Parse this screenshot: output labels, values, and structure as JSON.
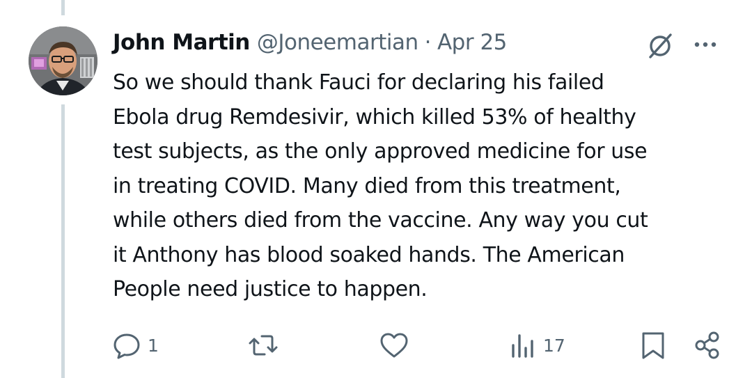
{
  "tweet": {
    "display_name": "John Martin",
    "handle": "@Joneemartian",
    "separator": "·",
    "date": "Apr 25",
    "text_lines": [
      "So we should thank Fauci for declaring his failed",
      "Ebola drug Remdesivir, which killed 53% of healthy",
      "test subjects, as the only approved medicine for use",
      "in treating COVID. Many died from this treatment,",
      "while others died from the vaccine. Any way you cut",
      "it Anthony has blood soaked hands. The American",
      "People need justice to happen."
    ]
  },
  "header_icons": {
    "grok": "grok-icon",
    "more": "more-icon"
  },
  "actions": {
    "reply": {
      "icon": "reply-icon",
      "count": "1"
    },
    "repost": {
      "icon": "repost-icon",
      "count": ""
    },
    "like": {
      "icon": "heart-icon",
      "count": ""
    },
    "views": {
      "icon": "views-icon",
      "count": "17"
    },
    "bookmark": {
      "icon": "bookmark-icon"
    },
    "share": {
      "icon": "share-icon"
    }
  },
  "colors": {
    "text": "#0f1419",
    "secondary": "#536471",
    "thread_line": "#cfd9de",
    "background": "#ffffff"
  }
}
